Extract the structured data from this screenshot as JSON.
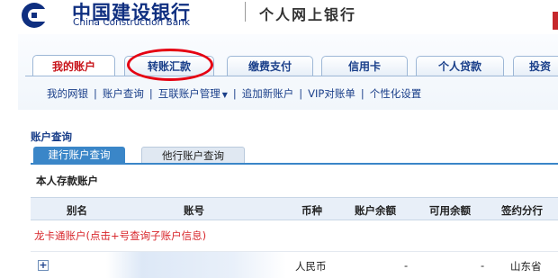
{
  "header": {
    "bank_name_cn": "中国建设银行",
    "bank_name_en": "China Construction Bank",
    "portal_title": "个人网上银行"
  },
  "nav": {
    "tabs": [
      {
        "label": "我的账户",
        "active": true
      },
      {
        "label": "转账汇款",
        "active": false,
        "highlighted": true
      },
      {
        "label": "缴费支付",
        "active": false
      },
      {
        "label": "信用卡",
        "active": false
      },
      {
        "label": "个人贷款",
        "active": false
      },
      {
        "label": "投资",
        "active": false
      }
    ],
    "subnav": [
      "我的网银",
      "账户查询",
      "互联账户管理",
      "追加新账户",
      "VIP对账单",
      "个性化设置"
    ]
  },
  "content": {
    "section_title": "账户查询",
    "subtabs": [
      "建行账户查询",
      "他行账户查询"
    ],
    "deposit_heading": "本人存款账户",
    "columns": [
      "别名",
      "账号",
      "币种",
      "账户余额",
      "可用余额",
      "签约分行"
    ],
    "long_card_label": "龙卡通账户(点击+号查询子账户信息)",
    "rows": [
      {
        "expand": "+",
        "alias": "",
        "account": "",
        "currency": "人民币",
        "balance": "-",
        "available": "-",
        "branch": "山东省"
      }
    ]
  },
  "colors": {
    "brand_blue": "#0f2f80",
    "accent_red": "#c8141a",
    "highlight_red": "#e50012",
    "subtab_blue": "#3a86c8"
  },
  "icons": {
    "logo": "ccb-logo-icon",
    "expand": "plus-icon",
    "dropdown": "caret-down-icon"
  }
}
